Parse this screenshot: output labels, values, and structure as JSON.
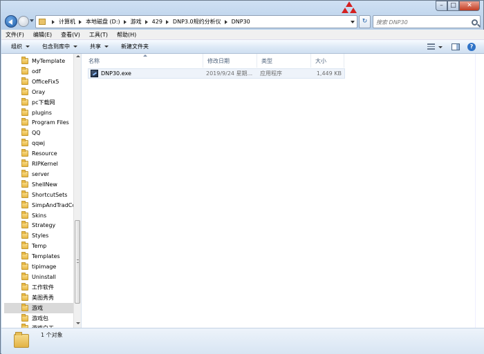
{
  "address": {
    "crumbs": [
      "计算机",
      "本地磁盘 (D:)",
      "游戏",
      "429",
      "DNP3.0规约分析仪",
      "DNP30"
    ]
  },
  "search": {
    "placeholder": "搜索 DNP30"
  },
  "menu": [
    "文件(F)",
    "编辑(E)",
    "查看(V)",
    "工具(T)",
    "帮助(H)"
  ],
  "toolbar": {
    "organize": "组织",
    "include_in_library": "包含到库中",
    "share": "共享",
    "new_folder": "新建文件夹"
  },
  "nav": {
    "items": [
      "MyTemplate",
      "odf",
      "OfficeFix5",
      "Oray",
      "pc下载网",
      "plugins",
      "Program Files",
      "QQ",
      "qqwj",
      "Resource",
      "RIPKernel",
      "server",
      "ShellNew",
      "ShortcutSets",
      "SimpAndTradCo",
      "Skins",
      "Strategy",
      "Styles",
      "Temp",
      "Templates",
      "tipimage",
      "Uninstall",
      "工作软件",
      "美图秀秀",
      "游戏",
      "游戏包",
      "游戏白工"
    ],
    "selected_index": 24
  },
  "columns": {
    "name": "名称",
    "modified": "修改日期",
    "type": "类型",
    "size": "大小"
  },
  "files": [
    {
      "name": "DNP30.exe",
      "modified": "2019/9/24 星期...",
      "type": "应用程序",
      "size": "1,449 KB",
      "icon": "exe-icon"
    }
  ],
  "status": {
    "text": "1 个对象"
  }
}
